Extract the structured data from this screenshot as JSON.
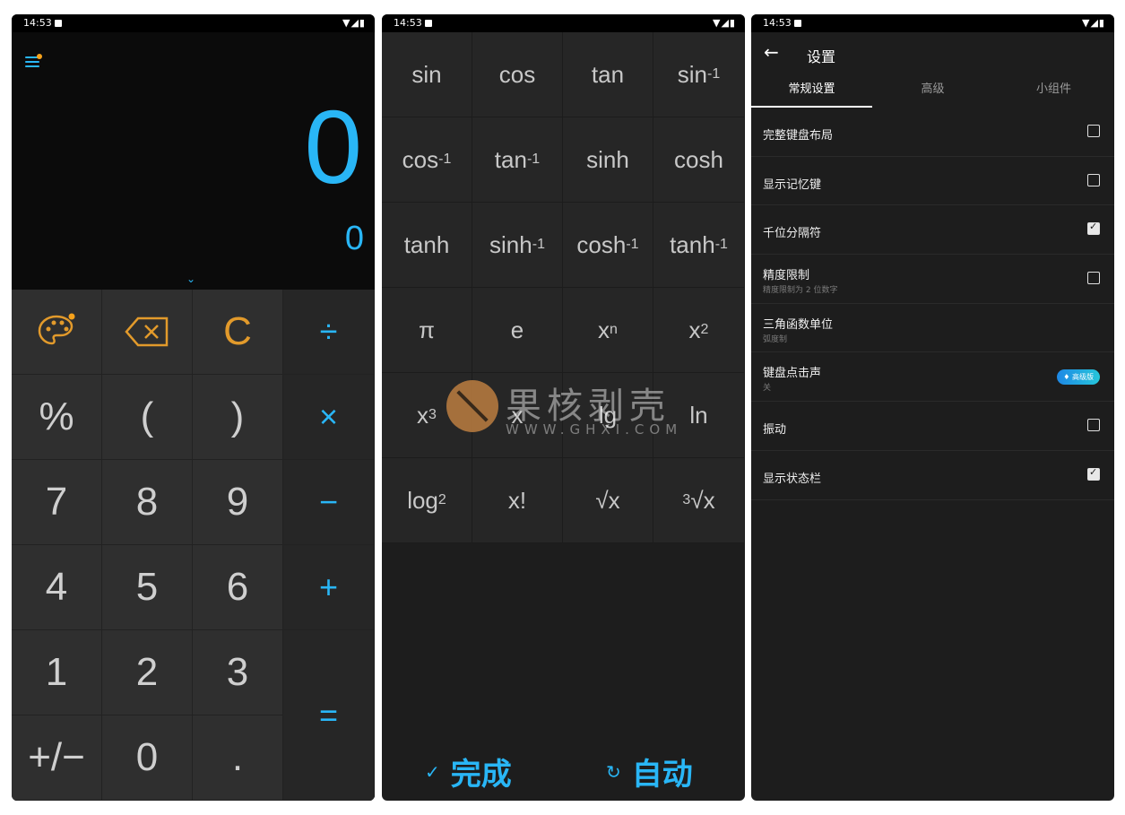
{
  "status": {
    "time": "14:53",
    "icons": "▼◢▮"
  },
  "calc": {
    "result": "0",
    "preview": "0",
    "keys": [
      {
        "label": "",
        "icon": "palette-icon",
        "kind": "orange"
      },
      {
        "label": "",
        "icon": "backspace-icon",
        "kind": "orange"
      },
      {
        "label": "C",
        "kind": "orange"
      },
      {
        "label": "÷",
        "kind": "op"
      },
      {
        "label": "%"
      },
      {
        "label": "("
      },
      {
        "label": ")"
      },
      {
        "label": "×",
        "kind": "op"
      },
      {
        "label": "7"
      },
      {
        "label": "8"
      },
      {
        "label": "9"
      },
      {
        "label": "−",
        "kind": "op"
      },
      {
        "label": "4"
      },
      {
        "label": "5"
      },
      {
        "label": "6"
      },
      {
        "label": "+",
        "kind": "op"
      },
      {
        "label": "1"
      },
      {
        "label": "2"
      },
      {
        "label": "3"
      },
      {
        "label": "=",
        "kind": "eq"
      },
      {
        "label": "+/−"
      },
      {
        "label": "0"
      },
      {
        "label": "."
      }
    ],
    "accent": "#29b6f6",
    "orange": "#e29a2b"
  },
  "functions": {
    "keys": [
      {
        "base": "sin",
        "sup": "",
        "sub": ""
      },
      {
        "base": "cos",
        "sup": "",
        "sub": ""
      },
      {
        "base": "tan",
        "sup": "",
        "sub": ""
      },
      {
        "base": "sin",
        "sup": "-1",
        "sub": ""
      },
      {
        "base": "cos",
        "sup": "-1",
        "sub": ""
      },
      {
        "base": "tan",
        "sup": "-1",
        "sub": ""
      },
      {
        "base": "sinh",
        "sup": "",
        "sub": ""
      },
      {
        "base": "cosh",
        "sup": "",
        "sub": ""
      },
      {
        "base": "tanh",
        "sup": "",
        "sub": ""
      },
      {
        "base": "sinh",
        "sup": "-1",
        "sub": ""
      },
      {
        "base": "cosh",
        "sup": "-1",
        "sub": ""
      },
      {
        "base": "tanh",
        "sup": "-1",
        "sub": ""
      },
      {
        "base": "π",
        "sup": "",
        "sub": ""
      },
      {
        "base": "e",
        "sup": "",
        "sub": ""
      },
      {
        "base": "x",
        "sup": "n",
        "sub": ""
      },
      {
        "base": "x",
        "sup": "2",
        "sub": ""
      },
      {
        "base": "x",
        "sup": "3",
        "sub": ""
      },
      {
        "base": "x",
        "sup": "",
        "sub": ""
      },
      {
        "base": "lg",
        "sup": "",
        "sub": ""
      },
      {
        "base": "ln",
        "sup": "",
        "sub": ""
      },
      {
        "base": "log",
        "sup": "",
        "sub": "2"
      },
      {
        "base": "x!",
        "sup": "",
        "sub": ""
      },
      {
        "base": "√x",
        "sup": "",
        "sub": ""
      },
      {
        "pre": "3",
        "base": "√x",
        "sup": "",
        "sub": ""
      }
    ],
    "done_label": "完成",
    "auto_label": "自动",
    "watermark_text": "果核剥壳",
    "watermark_url": "WWW.GHXI.COM"
  },
  "settings": {
    "title": "设置",
    "tabs": [
      {
        "label": "常规设置",
        "active": true
      },
      {
        "label": "高级",
        "active": false
      },
      {
        "label": "小组件",
        "active": false
      }
    ],
    "items": [
      {
        "title": "完整键盘布局",
        "subtitle": "",
        "control": "checkbox",
        "checked": false
      },
      {
        "title": "显示记忆键",
        "subtitle": "",
        "control": "checkbox",
        "checked": false
      },
      {
        "title": "千位分隔符",
        "subtitle": "",
        "control": "checkbox",
        "checked": true
      },
      {
        "title": "精度限制",
        "subtitle": "精度限制为 2 位数字",
        "control": "checkbox",
        "checked": false
      },
      {
        "title": "三角函数单位",
        "subtitle": "弧度制",
        "control": "none"
      },
      {
        "title": "键盘点击声",
        "subtitle": "关",
        "control": "badge",
        "badge": "高级版"
      },
      {
        "title": "振动",
        "subtitle": "",
        "control": "checkbox",
        "checked": false
      },
      {
        "title": "显示状态栏",
        "subtitle": "",
        "control": "checkbox",
        "checked": true
      }
    ]
  }
}
